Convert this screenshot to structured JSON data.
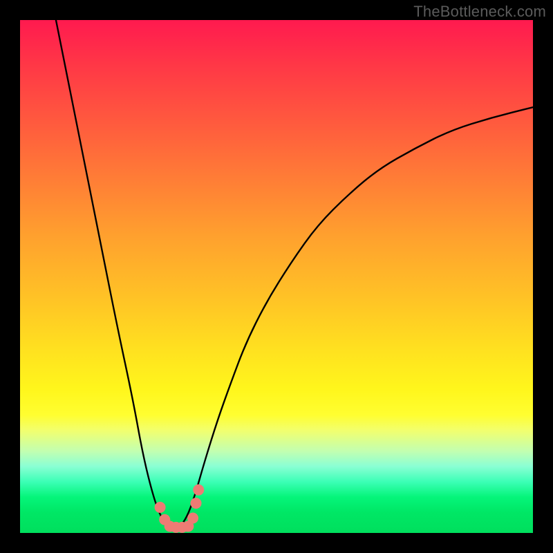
{
  "watermark": "TheBottleneck.com",
  "chart_data": {
    "type": "line",
    "title": "",
    "xlabel": "",
    "ylabel": "",
    "xlim": [
      0,
      100
    ],
    "ylim": [
      0,
      100
    ],
    "grid": false,
    "series": [
      {
        "name": "bottleneck-curve",
        "x": [
          7,
          10,
          13,
          16,
          19,
          22,
          24,
          26,
          27.5,
          29,
          30,
          31,
          32.5,
          34,
          36,
          38.5,
          41,
          44,
          48,
          53,
          58,
          64,
          70,
          77,
          84,
          92,
          100
        ],
        "y": [
          100,
          85,
          70,
          55,
          40,
          26,
          15,
          7,
          3,
          1,
          0.5,
          1,
          3,
          7,
          14,
          22,
          29,
          37,
          45,
          53,
          60,
          66,
          71,
          75,
          78.5,
          81,
          83
        ]
      }
    ],
    "flat_zone": {
      "x_start": 28.5,
      "x_end": 33.5,
      "y": 1.2
    },
    "markers": [
      {
        "x": 27.3,
        "y": 5.0,
        "r": 1.2
      },
      {
        "x": 28.2,
        "y": 2.6,
        "r": 1.2
      },
      {
        "x": 29.2,
        "y": 1.3,
        "r": 1.2
      },
      {
        "x": 30.4,
        "y": 1.1,
        "r": 1.2
      },
      {
        "x": 31.6,
        "y": 1.1,
        "r": 1.2
      },
      {
        "x": 32.8,
        "y": 1.3,
        "r": 1.2
      },
      {
        "x": 33.7,
        "y": 2.9,
        "r": 1.2
      },
      {
        "x": 34.3,
        "y": 5.8,
        "r": 1.2
      },
      {
        "x": 34.8,
        "y": 8.4,
        "r": 1.2
      }
    ],
    "colors": {
      "curve": "#000000",
      "marker": "#ed7b74",
      "flat_zone": "#ed7b74"
    }
  }
}
